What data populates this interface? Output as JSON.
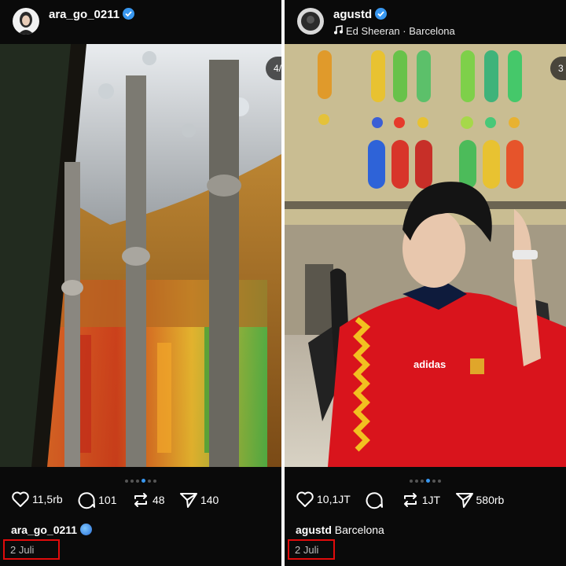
{
  "left_post": {
    "username": "ara_go_0211",
    "slide_counter": "4/",
    "likes": "11,5rb",
    "comments": "101",
    "reposts": "48",
    "shares": "140",
    "caption_user": "ara_go_0211",
    "caption_text": "",
    "date": "2 Juli"
  },
  "right_post": {
    "username": "agustd",
    "music_line": "Ed Sheeran · Barcelona",
    "slide_counter": "3",
    "likes": "10,1JT",
    "comments": "",
    "reposts": "1JT",
    "shares": "580rb",
    "caption_user": "agustd",
    "caption_text": "Barcelona",
    "date": "2 Juli",
    "shirt_brand": "adidas"
  },
  "colors": {
    "verified": "#3897f0",
    "highlight_box": "#e00b0b",
    "jersey_red": "#d9141c",
    "background": "#0a0a0a"
  },
  "icons": {
    "like": "heart-outline-icon",
    "comment": "speech-bubble-icon",
    "repost": "repost-arrows-icon",
    "share": "send-plane-icon",
    "verified": "verified-badge-icon",
    "music": "music-note-icon",
    "globe": "globe-emoji-icon"
  }
}
